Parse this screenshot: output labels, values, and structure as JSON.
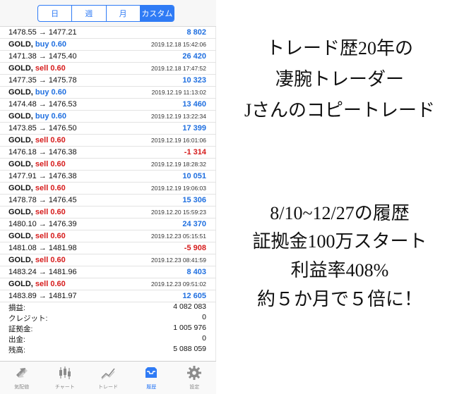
{
  "segments": [
    "日",
    "週",
    "月",
    "カスタム"
  ],
  "active_segment": 3,
  "first_row": {
    "prices": "1478.55 → 1477.21",
    "profit": "8 802"
  },
  "trades": [
    {
      "symbol": "GOLD,",
      "side": "buy",
      "volume": "0.60",
      "time": "2019.12.18 15:42:06",
      "prices": "1471.38 → 1475.40",
      "profit": "26 420"
    },
    {
      "symbol": "GOLD,",
      "side": "sell",
      "volume": "0.60",
      "time": "2019.12.18 17:47:52",
      "prices": "1477.35 → 1475.78",
      "profit": "10 323"
    },
    {
      "symbol": "GOLD,",
      "side": "buy",
      "volume": "0.60",
      "time": "2019.12.19 11:13:02",
      "prices": "1474.48 → 1476.53",
      "profit": "13 460"
    },
    {
      "symbol": "GOLD,",
      "side": "buy",
      "volume": "0.60",
      "time": "2019.12.19 13:22:34",
      "prices": "1473.85 → 1476.50",
      "profit": "17 399"
    },
    {
      "symbol": "GOLD,",
      "side": "sell",
      "volume": "0.60",
      "time": "2019.12.19 16:01:06",
      "prices": "1476.18 → 1476.38",
      "profit": "-1 314"
    },
    {
      "symbol": "GOLD,",
      "side": "sell",
      "volume": "0.60",
      "time": "2019.12.19 18:28:32",
      "prices": "1477.91 → 1476.38",
      "profit": "10 051"
    },
    {
      "symbol": "GOLD,",
      "side": "sell",
      "volume": "0.60",
      "time": "2019.12.19 19:06:03",
      "prices": "1478.78 → 1476.45",
      "profit": "15 306"
    },
    {
      "symbol": "GOLD,",
      "side": "sell",
      "volume": "0.60",
      "time": "2019.12.20 15:59:23",
      "prices": "1480.10 → 1476.39",
      "profit": "24 370"
    },
    {
      "symbol": "GOLD,",
      "side": "sell",
      "volume": "0.60",
      "time": "2019.12.23 05:15:51",
      "prices": "1481.08 → 1481.98",
      "profit": "-5 908"
    },
    {
      "symbol": "GOLD,",
      "side": "sell",
      "volume": "0.60",
      "time": "2019.12.23 08:41:59",
      "prices": "1483.24 → 1481.96",
      "profit": "8 403"
    },
    {
      "symbol": "GOLD,",
      "side": "sell",
      "volume": "0.60",
      "time": "2019.12.23 09:51:02",
      "prices": "1483.89 → 1481.97",
      "profit": "12 605"
    }
  ],
  "summary": [
    {
      "label": "損益:",
      "value": "4 082 083"
    },
    {
      "label": "クレジット:",
      "value": "0"
    },
    {
      "label": "証拠金:",
      "value": "1 005 976"
    },
    {
      "label": "出金:",
      "value": "0"
    },
    {
      "label": "残高:",
      "value": "5 088 059"
    }
  ],
  "tabs": [
    {
      "label": "気配値",
      "icon": "quotes-icon"
    },
    {
      "label": "チャート",
      "icon": "candlestick-chart-icon"
    },
    {
      "label": "トレード",
      "icon": "trade-line-icon"
    },
    {
      "label": "履歴",
      "icon": "history-inbox-icon"
    },
    {
      "label": "設定",
      "icon": "settings-gear-icon"
    }
  ],
  "active_tab": 3,
  "colors": {
    "accent": "#2f7bf5",
    "buy": "#1f6fe0",
    "sell": "#d61b1b"
  },
  "caption": {
    "line1": "トレード歴20年の",
    "line2": "凄腕トレーダー",
    "line3": "Jさんのコピートレード",
    "line4": "8/10~12/27の履歴",
    "line5": "証拠金100万スタート",
    "line6": "利益率408%",
    "line7": "約５か月で５倍に！"
  }
}
